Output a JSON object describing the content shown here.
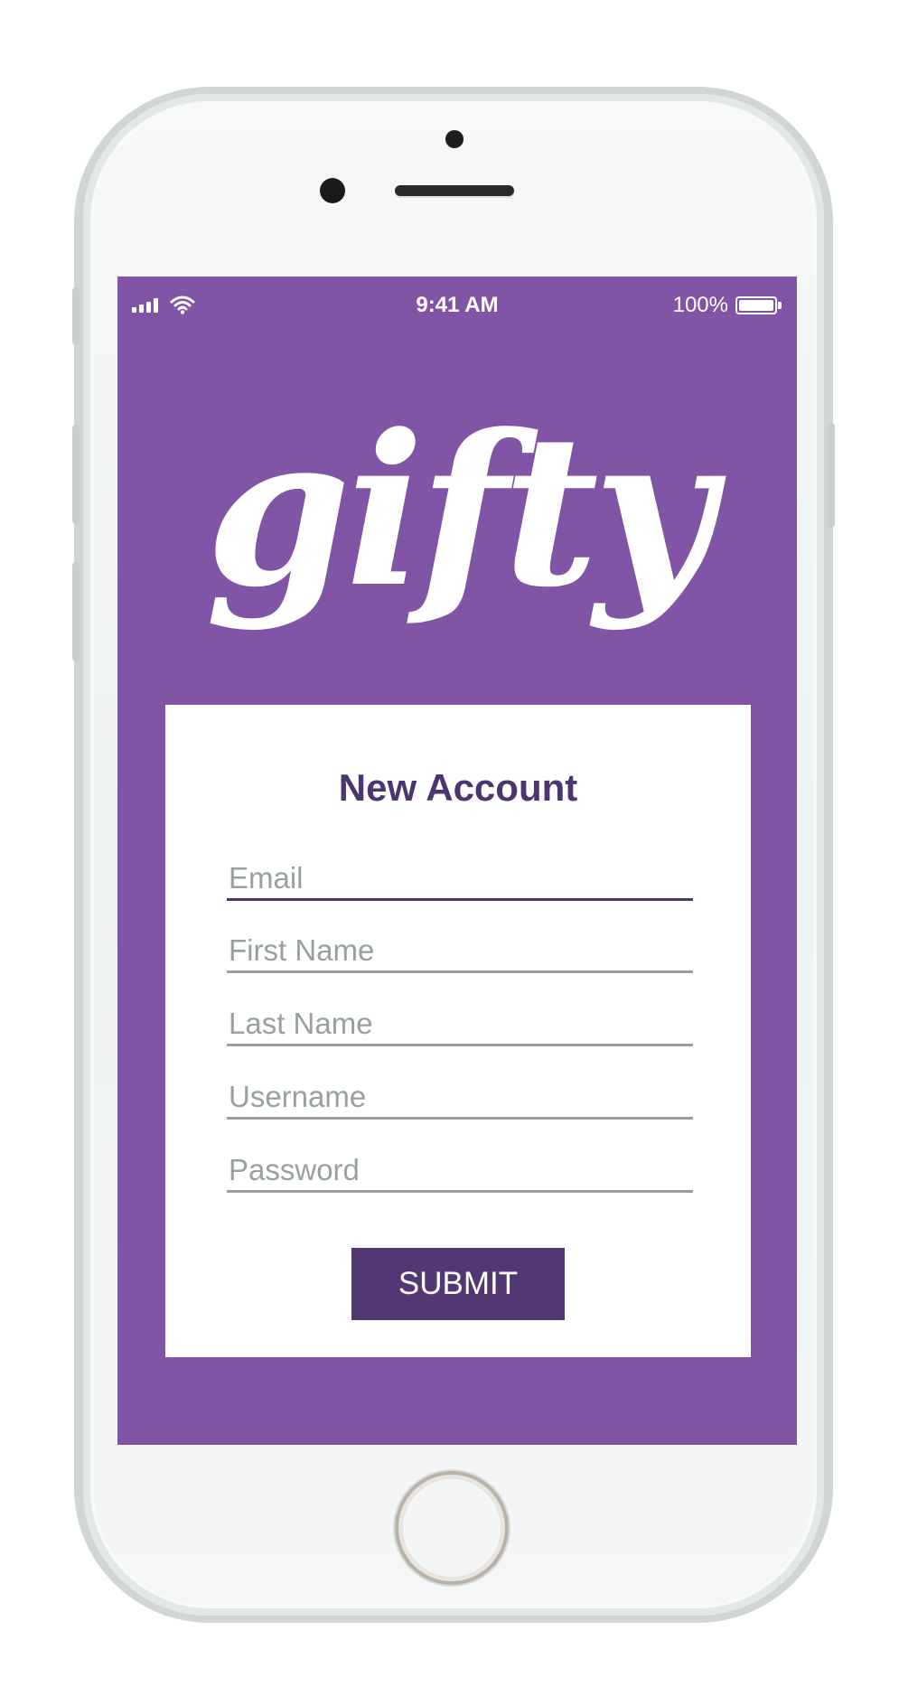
{
  "status_bar": {
    "time": "9:41 AM",
    "battery_percent": "100%",
    "signal_icon": "signal-bars-icon",
    "wifi_icon": "wifi-icon",
    "battery_icon": "battery-icon"
  },
  "app": {
    "logo_text": "gifty",
    "brand_color": "#8155a6",
    "accent_color": "#523873"
  },
  "form": {
    "title": "New Account",
    "fields": [
      {
        "placeholder": "Email",
        "value": "",
        "focused": true
      },
      {
        "placeholder": "First Name",
        "value": ""
      },
      {
        "placeholder": "Last Name",
        "value": ""
      },
      {
        "placeholder": "Username",
        "value": ""
      },
      {
        "placeholder": "Password",
        "value": ""
      }
    ],
    "submit_label": "SUBMIT"
  }
}
